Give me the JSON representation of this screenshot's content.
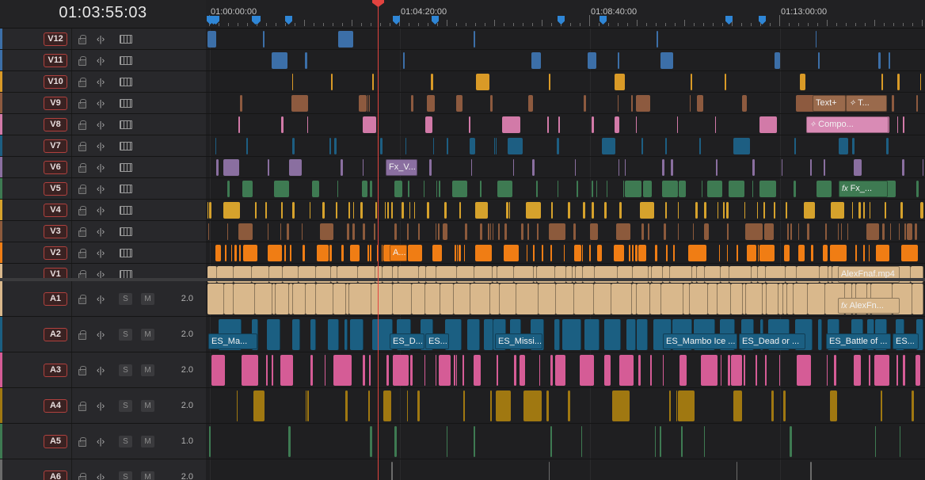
{
  "timecode": "01:03:55:03",
  "ruler": {
    "labels": [
      "01:00:00:00",
      "01:04:20:00",
      "01:08:40:00",
      "01:13:00:00"
    ],
    "marker_color": "#2f86d6"
  },
  "playhead_color": "#e2433f",
  "video_tracks": [
    {
      "id": "V12",
      "color": "#3c6fa8"
    },
    {
      "id": "V11",
      "color": "#3c6fa8"
    },
    {
      "id": "V10",
      "color": "#d99a27"
    },
    {
      "id": "V9",
      "color": "#8d5a3f"
    },
    {
      "id": "V8",
      "color": "#d27aa8"
    },
    {
      "id": "V7",
      "color": "#1d5e82"
    },
    {
      "id": "V6",
      "color": "#8a6fa0"
    },
    {
      "id": "V5",
      "color": "#3e7a52"
    },
    {
      "id": "V4",
      "color": "#d6a22c"
    },
    {
      "id": "V3",
      "color": "#8c5a3c"
    },
    {
      "id": "V2",
      "color": "#f07d14"
    },
    {
      "id": "V1",
      "color": "#d9b88c"
    }
  ],
  "audio_tracks": [
    {
      "id": "A1",
      "volume": "2.0",
      "color": "#d9b88c"
    },
    {
      "id": "A2",
      "volume": "2.0",
      "color": "#1b5f82"
    },
    {
      "id": "A3",
      "volume": "2.0",
      "color": "#d55c96"
    },
    {
      "id": "A4",
      "volume": "2.0",
      "color": "#a07811"
    },
    {
      "id": "A5",
      "volume": "1.0",
      "color": "#3e7a52"
    },
    {
      "id": "A6",
      "volume": "2.0",
      "color": "#6b6b6b"
    }
  ],
  "audio_buttons": {
    "solo": "S",
    "mute": "M"
  },
  "clips": [
    {
      "track": "V9",
      "label": "Text+",
      "color": "#9a6a4c"
    },
    {
      "track": "V9",
      "label": "T...",
      "color": "#9a6a4c",
      "icon": "sparkle-icon"
    },
    {
      "track": "V8",
      "label": "Compo...",
      "color": "#d98bb5",
      "icon": "sparkle-icon"
    },
    {
      "track": "V6",
      "label": "Fx_V...",
      "color": "#8a6fa0"
    },
    {
      "track": "V5",
      "label": "Fx_...",
      "color": "#3e7a52",
      "icon": "fx-icon"
    },
    {
      "track": "V2",
      "label": "A...",
      "color": "#f07d14"
    },
    {
      "track": "V1",
      "label": "AlexFnaf.mp4",
      "color": "#d9b88c"
    },
    {
      "track": "A1",
      "label": "AlexFn...",
      "color": "#d9b88c",
      "icon": "fx-icon"
    },
    {
      "track": "A2",
      "label": "ES_Ma...",
      "color": "#1b5f82"
    },
    {
      "track": "A2",
      "label": "ES_D...",
      "color": "#1b5f82"
    },
    {
      "track": "A2",
      "label": "ES...",
      "color": "#1b5f82"
    },
    {
      "track": "A2",
      "label": "ES_Missi...",
      "color": "#1b5f82"
    },
    {
      "track": "A2",
      "label": "ES_Mambo Ice ...",
      "color": "#1b5f82"
    },
    {
      "track": "A2",
      "label": "ES_Dead or ...",
      "color": "#1b5f82"
    },
    {
      "track": "A2",
      "label": "ES_Battle of ...",
      "color": "#1b5f82"
    },
    {
      "track": "A2",
      "label": "ES...",
      "color": "#1b5f82"
    }
  ]
}
